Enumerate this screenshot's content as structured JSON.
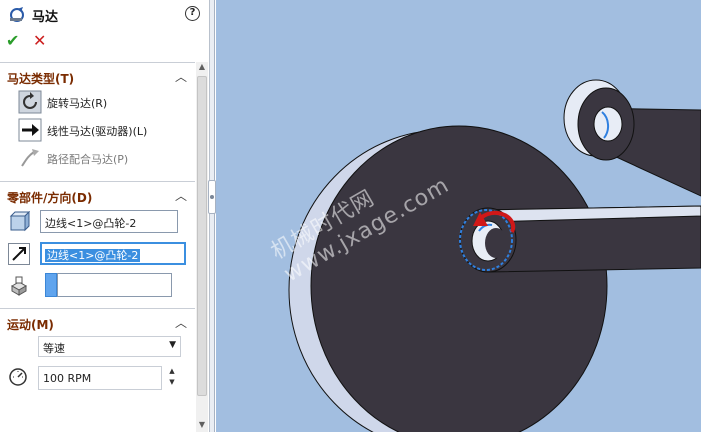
{
  "property_manager": {
    "title": "马达",
    "help_symbol": "?",
    "ok_symbol": "✔",
    "cancel_symbol": "✕"
  },
  "motor_type": {
    "header": "马达类型(T)",
    "options": [
      {
        "label": "旋转马达(R)",
        "icon": "rotary-motor-icon",
        "selected": true
      },
      {
        "label": "线性马达(驱动器)(L)",
        "icon": "linear-motor-icon",
        "selected": false
      },
      {
        "label": "路径配合马达(P)",
        "icon": "path-mate-motor-icon",
        "enabled": false
      }
    ]
  },
  "component_direction": {
    "header": "零部件/方向(D)",
    "motor_location": "边线<1>@凸轮-2",
    "motor_direction": "边线<1>@凸轮-2",
    "component_to_move": ""
  },
  "motion": {
    "header": "运动(M)",
    "function": "等速",
    "speed": "100 RPM"
  },
  "viewport": {
    "watermark_line1": "机械时代网",
    "watermark_line2": "www.jxage.com",
    "background_color": "#a2bee0",
    "part_color": "#3a3640",
    "highlight_color": "#2f80e0",
    "arrow_color": "#d01818"
  }
}
